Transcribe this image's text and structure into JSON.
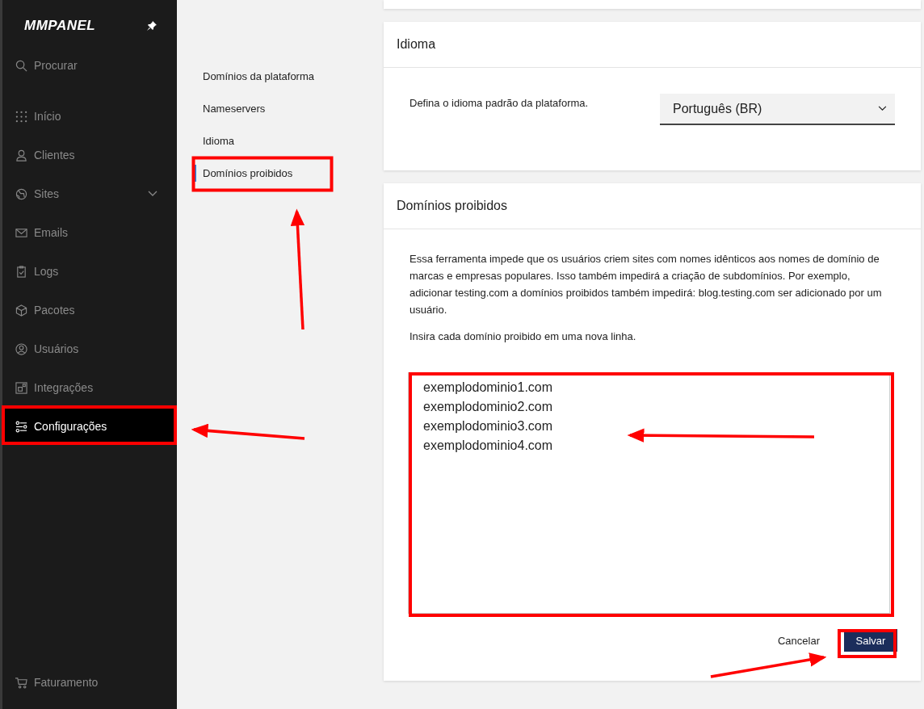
{
  "sidebar": {
    "logo": "MMPANEL",
    "search": {
      "placeholder": "Procurar"
    },
    "items": [
      {
        "label": "Início",
        "selected": false,
        "has_submenu": false
      },
      {
        "label": "Clientes",
        "selected": false,
        "has_submenu": false
      },
      {
        "label": "Sites",
        "selected": false,
        "has_submenu": true
      },
      {
        "label": "Emails",
        "selected": false,
        "has_submenu": false
      },
      {
        "label": "Logs",
        "selected": false,
        "has_submenu": false
      },
      {
        "label": "Pacotes",
        "selected": false,
        "has_submenu": false
      },
      {
        "label": "Usuários",
        "selected": false,
        "has_submenu": false
      },
      {
        "label": "Integrações",
        "selected": false,
        "has_submenu": false
      },
      {
        "label": "Configurações",
        "selected": true,
        "has_submenu": false
      }
    ],
    "footer_item": {
      "label": "Faturamento"
    }
  },
  "settings_nav": [
    {
      "label": "Domínios da plataforma",
      "selected": false
    },
    {
      "label": "Nameservers",
      "selected": false
    },
    {
      "label": "Idioma",
      "selected": false
    },
    {
      "label": "Domínios proibidos",
      "selected": true
    }
  ],
  "language_card": {
    "title": "Idioma",
    "description": "Defina o idioma padrão da plataforma.",
    "select": {
      "value": "Português (BR)"
    }
  },
  "banned_card": {
    "title": "Domínios proibidos",
    "paragraphs": [
      "Essa ferramenta impede que os usuários criem sites com nomes idênticos aos nomes de domínio de marcas e empresas populares. Isso também impedirá a criação de subdomínios. Por exemplo, adicionar testing.com a domínios proibidos também impedirá: blog.testing.com ser adicionado por um usuário.",
      "Insira cada domínio proibido em uma nova linha."
    ],
    "domains": [
      "exemplodominio1.com",
      "exemplodominio2.com",
      "exemplodominio3.com",
      "exemplodominio4.com"
    ],
    "cancel_button": "Cancelar",
    "save_button": "Salvar"
  }
}
